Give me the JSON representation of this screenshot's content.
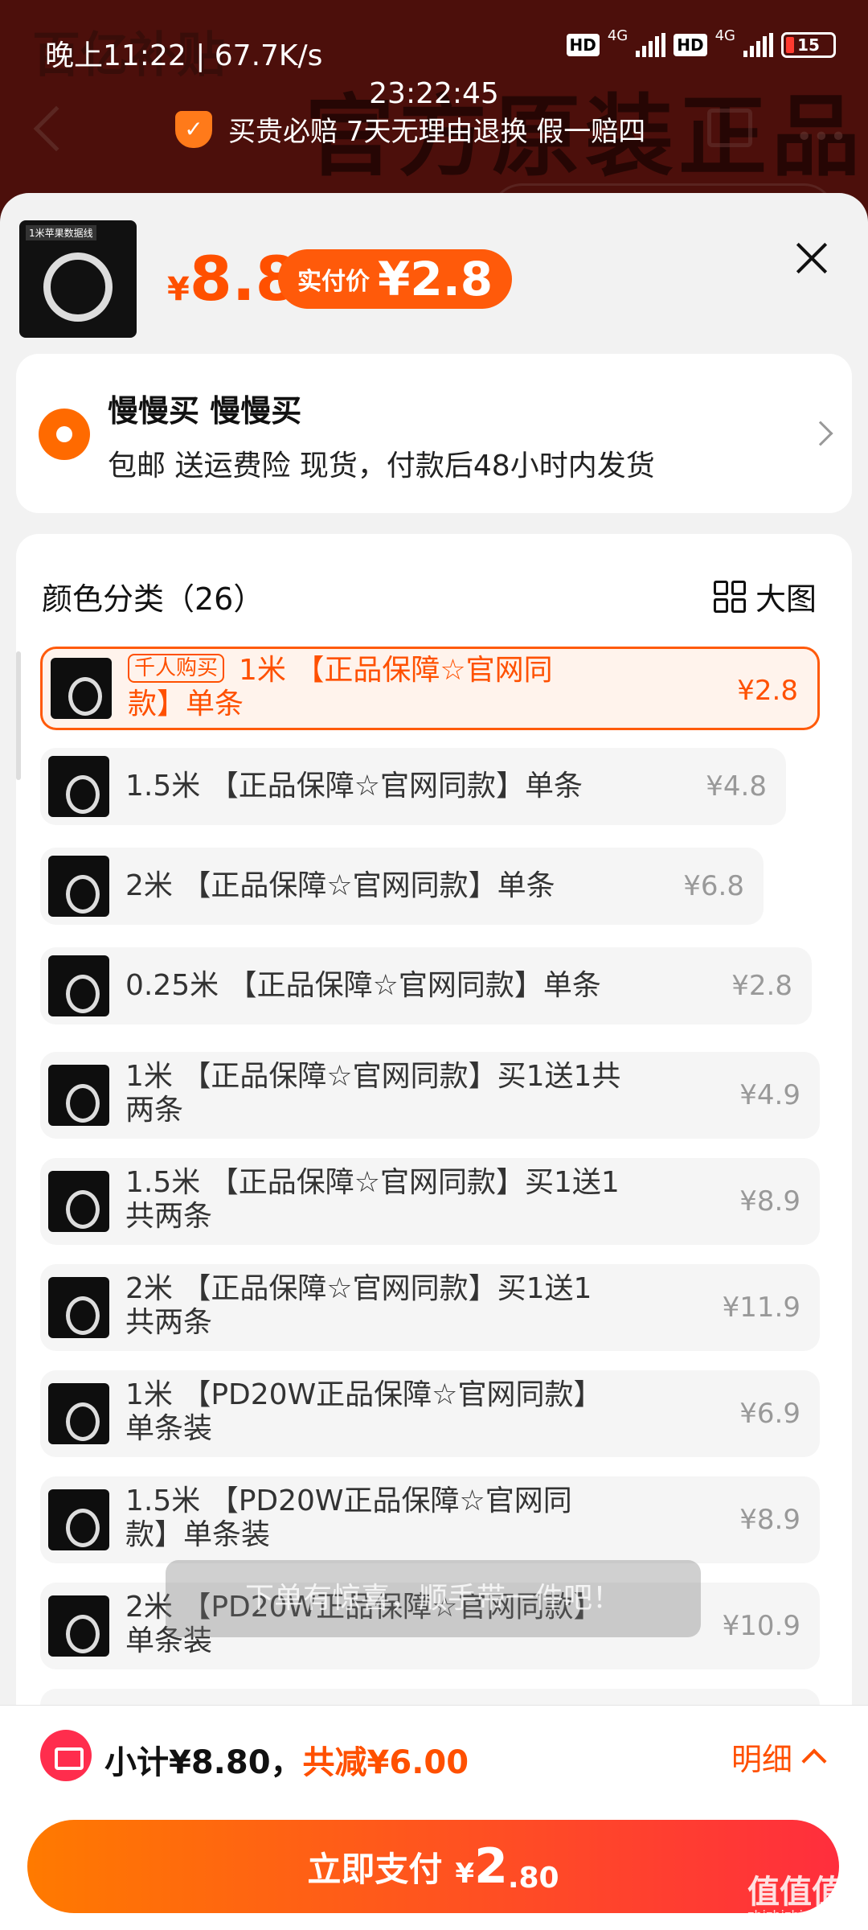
{
  "status_bar": {
    "left_text": "晚上11:22 | 67.7K/s",
    "network_1": "4G",
    "network_2": "4G",
    "hd_badge": "HD",
    "battery": "15",
    "clock": "23:22:45"
  },
  "background": {
    "banner_text": "官方原装正品"
  },
  "guarantee": {
    "text": "买贵必赔  7天无理由退换  假一赔四",
    "icon": "shield-check-icon"
  },
  "product": {
    "thumb_tag": "1米苹果数据线",
    "price_currency": "¥",
    "price": "8.8",
    "paid_label": "实付价",
    "paid_price": "¥2.8"
  },
  "address": {
    "name": "慢慢买 慢慢买",
    "description": "包邮  送运费险  现货，付款后48小时内发货",
    "icon": "location-pin-icon"
  },
  "options": {
    "title": "颜色分类（26）",
    "big_view_label": "大图",
    "hot_tag": "千人购买",
    "items": [
      {
        "label": "1米 【正品保障☆官网同",
        "label2": "款】单条",
        "price": "¥2.8"
      },
      {
        "label": "1.5米 【正品保障☆官网同款】单条",
        "label2": "",
        "price": "¥4.8"
      },
      {
        "label": "2米 【正品保障☆官网同款】单条",
        "label2": "",
        "price": "¥6.8"
      },
      {
        "label": "0.25米 【正品保障☆官网同款】单条",
        "label2": "",
        "price": "¥2.8"
      },
      {
        "label": "1米 【正品保障☆官网同款】买1送1共",
        "label2": "两条",
        "price": "¥4.9"
      },
      {
        "label": "1.5米 【正品保障☆官网同款】买1送1",
        "label2": "共两条",
        "price": "¥8.9"
      },
      {
        "label": "2米 【正品保障☆官网同款】买1送1",
        "label2": "共两条",
        "price": "¥11.9"
      },
      {
        "label": "1米 【PD20W正品保障☆官网同款】",
        "label2": "单条装",
        "price": "¥6.9"
      },
      {
        "label": "1.5米 【PD20W正品保障☆官网同",
        "label2": "款】单条装",
        "price": "¥8.9"
      },
      {
        "label": "2米 【PD20W正品保障☆官网同款】",
        "label2": "单条装",
        "price": "¥10.9"
      }
    ]
  },
  "toast": {
    "text": "下单有惊喜，顺手带一件吧！"
  },
  "bottom": {
    "subtotal": "小计¥8.80，",
    "discount": "共减¥6.00",
    "details_label": "明细",
    "pay_label": "立即支付",
    "pay_currency": "¥",
    "pay_big": "2",
    "pay_small": ".80"
  },
  "watermark": {
    "text": "值值值",
    "sub": "zhizhizhi.com"
  },
  "colors": {
    "accent": "#ff5000",
    "pay_gradient_start": "#ff7a00",
    "pay_gradient_end": "#ff2e3d"
  }
}
